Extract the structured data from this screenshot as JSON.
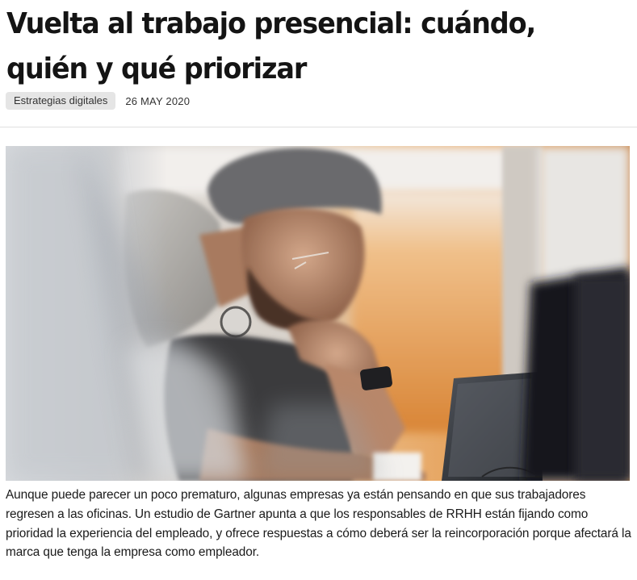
{
  "article": {
    "title": "Vuelta al trabajo presencial: cuándo, quién y qué priorizar",
    "category": "Estrategias digitales",
    "date": "26 MAY 2020",
    "body": "Aunque puede parecer un poco prematuro, algunas empresas ya están pensando en que sus trabajadores regresen a las oficinas. Un estudio de Gartner apunta a que los responsables de RRHH están fijando como prioridad la experiencia del empleado, y ofrece respuestas a cómo deberá ser la reincorporación porque afectará la marca que tenga la empresa como empleador."
  },
  "hero_image": {
    "subject": "man-working-at-laptop-photo"
  },
  "colors": {
    "tag_background": "#e5e5e5",
    "title_text": "#141414",
    "divider": "#e0e0e0",
    "warm_background": "#e8a35c"
  }
}
